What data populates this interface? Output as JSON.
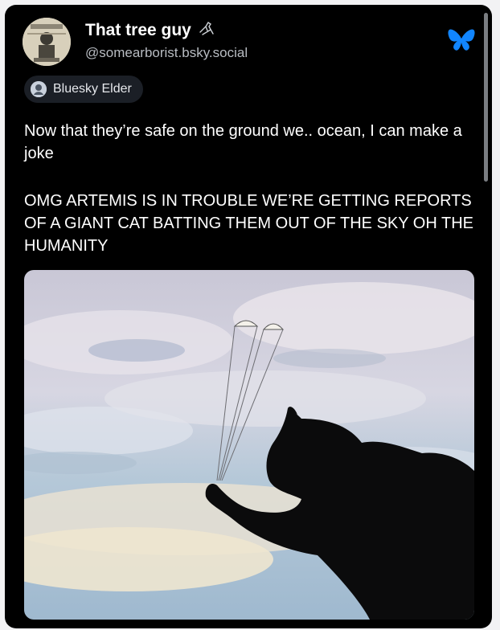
{
  "post": {
    "author_name": "That tree guy",
    "author_handle": "@somearborist.bsky.social",
    "badge_label": "Bluesky Elder",
    "text_paragraph_1": "Now that they’re safe on the ground we.. ocean, I can make a joke",
    "text_paragraph_2": "OMG ARTEMIS IS IN TROUBLE WE’RE GETTING REPORTS OF A GIANT CAT BATTING THEM OUT OF THE SKY OH THE HUMANITY"
  },
  "icons": {
    "author_suffix_icon": "bird-icon",
    "platform_logo": "bluesky-butterfly-icon",
    "badge_icon": "bluesky-elder-badge-icon"
  },
  "colors": {
    "card_background": "#000000",
    "brand_blue": "#1185fe",
    "handle_gray": "#b8bcc2"
  }
}
